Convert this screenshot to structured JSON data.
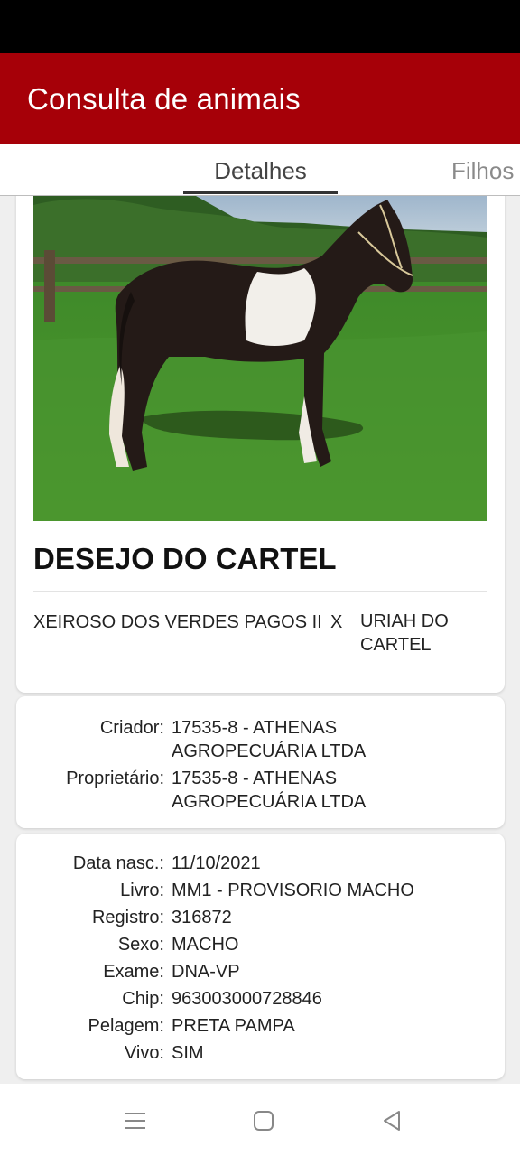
{
  "app": {
    "title": "Consulta de animais"
  },
  "tabs": [
    {
      "label": "Detalhes",
      "active": true
    },
    {
      "label": "Filhos",
      "active": false
    }
  ],
  "animal": {
    "name": "DESEJO DO CARTEL",
    "sire": "XEIROSO DOS VERDES PAGOS II",
    "cross_symbol": "X",
    "dam": "URIAH DO CARTEL"
  },
  "ownership": [
    {
      "label": "Criador:",
      "value": "17535-8 - ATHENAS AGROPECUÁRIA LTDA"
    },
    {
      "label": "Proprietário:",
      "value": "17535-8 - ATHENAS AGROPECUÁRIA LTDA"
    }
  ],
  "info": [
    {
      "label": "Data nasc.:",
      "value": "11/10/2021"
    },
    {
      "label": "Livro:",
      "value": "MM1 - PROVISORIO MACHO"
    },
    {
      "label": "Registro:",
      "value": "316872"
    },
    {
      "label": "Sexo:",
      "value": "MACHO"
    },
    {
      "label": "Exame:",
      "value": "DNA-VP"
    },
    {
      "label": "Chip:",
      "value": "963003000728846"
    },
    {
      "label": "Pelagem:",
      "value": "PRETA PAMPA"
    },
    {
      "label": "Vivo:",
      "value": "SIM"
    }
  ],
  "system_nav": {
    "icons": [
      "menu-icon",
      "home-icon",
      "back-icon"
    ]
  },
  "colors": {
    "app_bar": "#a60008",
    "status_bar": "#000000",
    "background": "#efefef"
  }
}
